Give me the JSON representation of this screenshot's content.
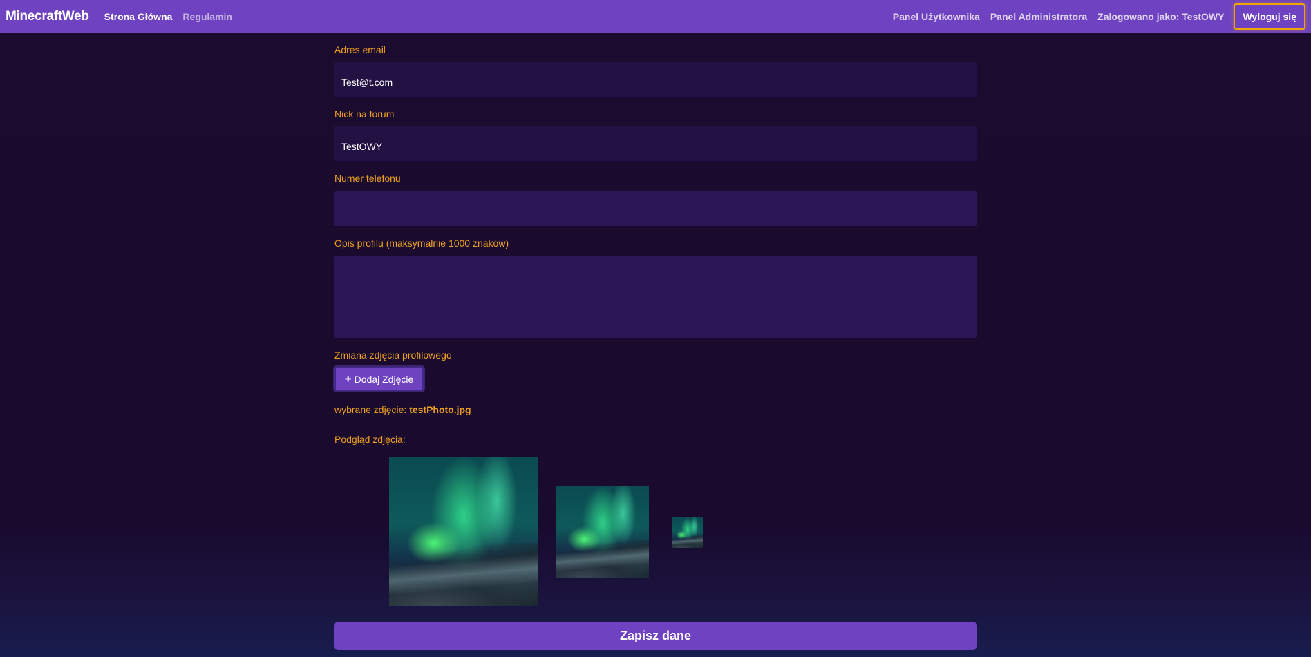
{
  "navbar": {
    "brand": "MinecraftWeb",
    "left_links": [
      "Strona Główna",
      "Regulamin"
    ],
    "right_links": [
      "Panel Użytkownika",
      "Panel Administratora",
      "Zalogowano jako: TestOWY"
    ],
    "logout_label": "Wyloguj się"
  },
  "form": {
    "email": {
      "label": "Adres email",
      "value": "Test@t.com"
    },
    "nick": {
      "label": "Nick na forum",
      "value": "TestOWY"
    },
    "phone": {
      "label": "Numer telefonu",
      "value": ""
    },
    "description": {
      "label": "Opis profilu (maksymalnie 1000 znaków)",
      "value": ""
    },
    "photo": {
      "label": "Zmiana zdjęcia profilowego",
      "add_button_label": "Dodaj Zdjęcie",
      "selected_prefix": "wybrane zdjęcie:",
      "selected_file": "testPhoto.jpg",
      "preview_label": "Podgląd zdjęcia:"
    },
    "save_label": "Zapisz dane"
  },
  "colors": {
    "accent": "#6f42c1",
    "label": "#f0a020",
    "background": "#1a0b2f",
    "field": "#231143"
  },
  "icons": [
    "plus-icon"
  ]
}
